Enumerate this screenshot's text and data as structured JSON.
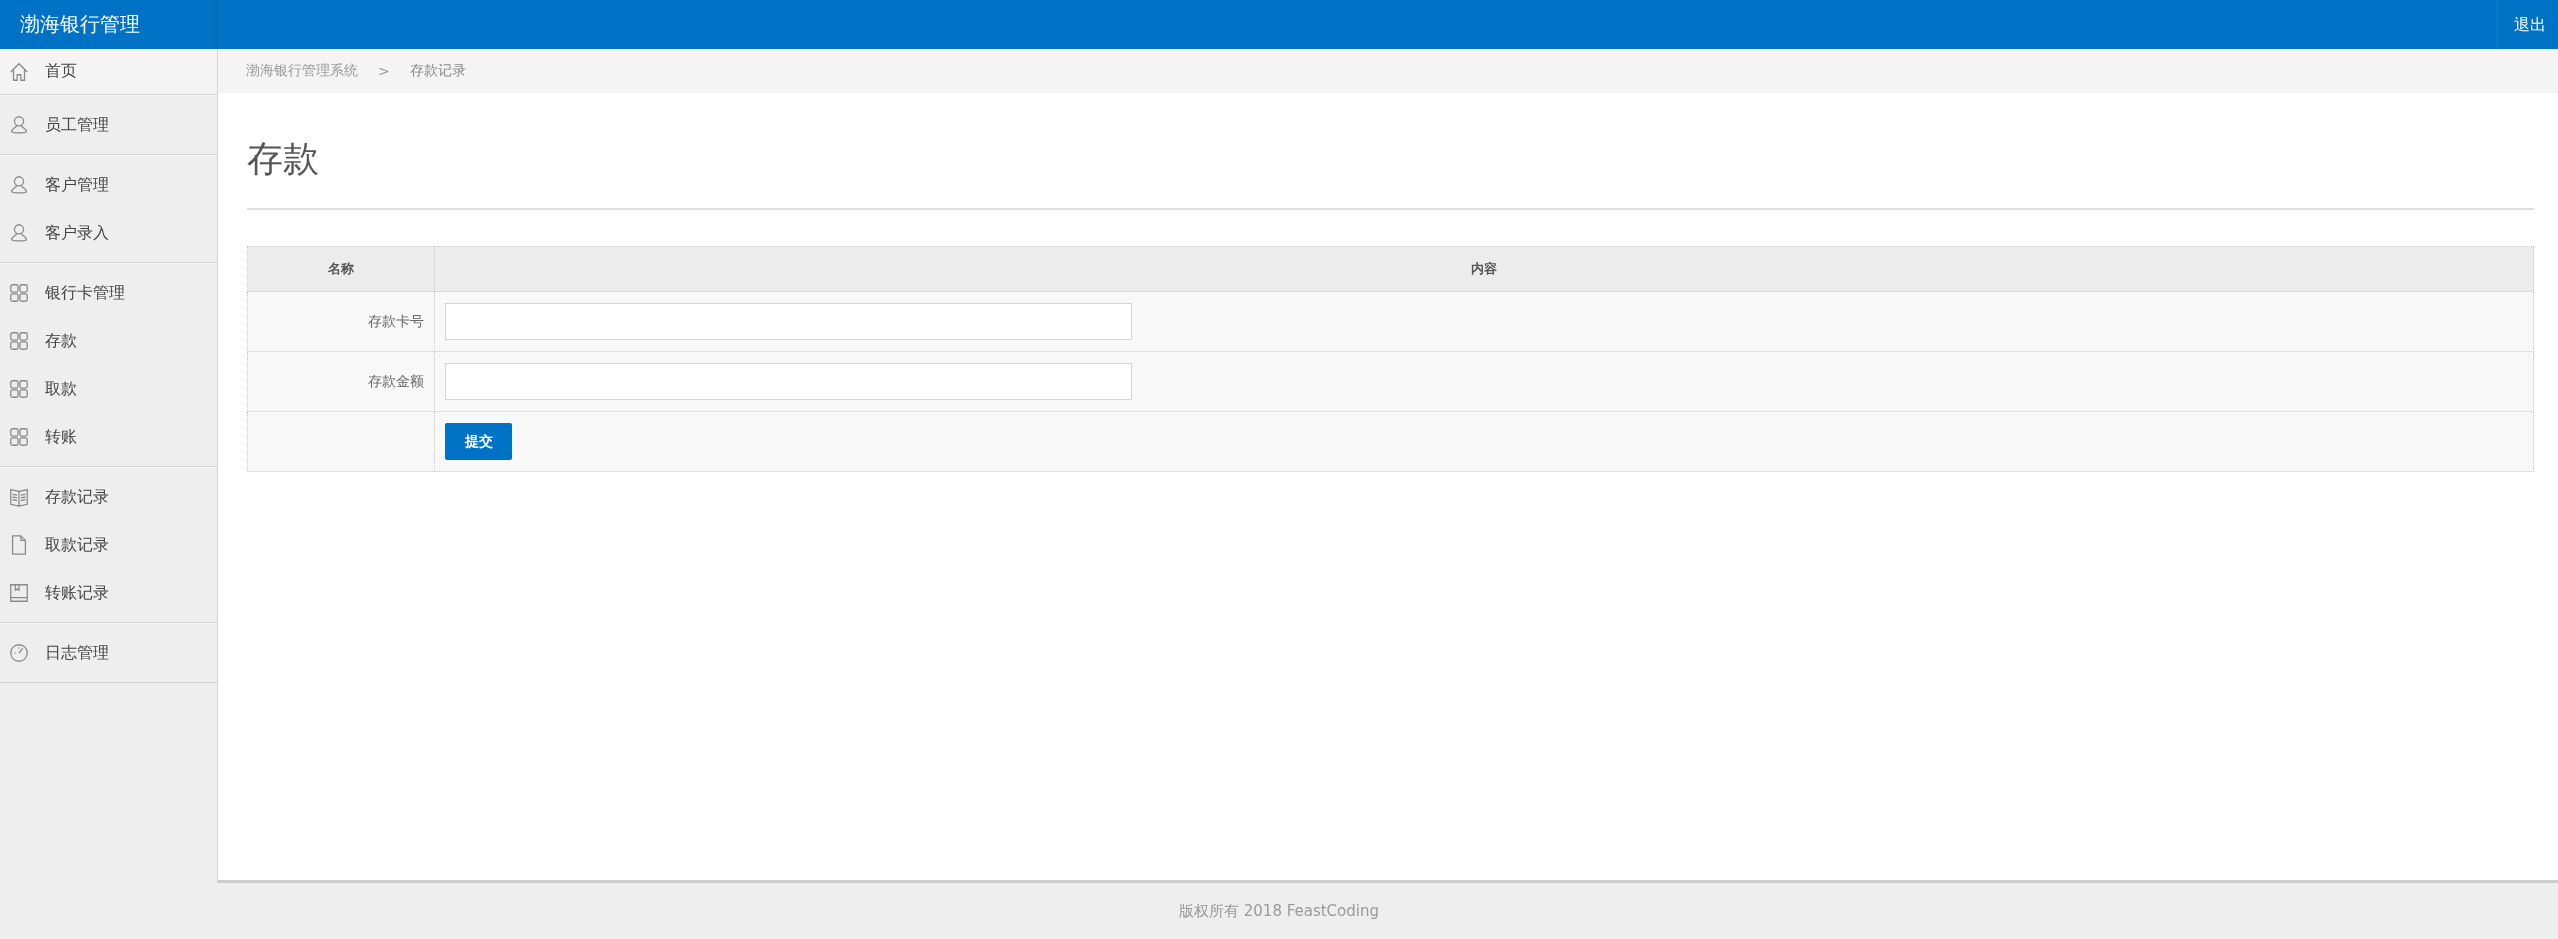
{
  "header": {
    "brand": "渤海银行管理",
    "logout": "退出"
  },
  "sidebar": {
    "groups": [
      {
        "items": [
          {
            "label": "首页",
            "kind": "home",
            "selected": true
          }
        ]
      },
      {
        "items": [
          {
            "label": "员工管理",
            "kind": "person",
            "selected": false
          }
        ]
      },
      {
        "items": [
          {
            "label": "客户管理",
            "kind": "person",
            "selected": false
          },
          {
            "label": "客户录入",
            "kind": "person",
            "selected": false
          }
        ]
      },
      {
        "items": [
          {
            "label": "银行卡管理",
            "kind": "grid",
            "selected": false
          },
          {
            "label": "存款",
            "kind": "grid",
            "selected": false
          },
          {
            "label": "取款",
            "kind": "grid",
            "selected": false
          },
          {
            "label": "转账",
            "kind": "grid",
            "selected": false
          }
        ]
      },
      {
        "items": [
          {
            "label": "存款记录",
            "kind": "book",
            "selected": false
          },
          {
            "label": "取款记录",
            "kind": "file",
            "selected": false
          },
          {
            "label": "转账记录",
            "kind": "notebook",
            "selected": false
          }
        ]
      },
      {
        "items": [
          {
            "label": "日志管理",
            "kind": "gauge",
            "selected": false
          }
        ]
      }
    ]
  },
  "breadcrumb": [
    "渤海银行管理系统",
    ">",
    "存款记录"
  ],
  "page_title": "存款",
  "form_table": {
    "columns": [
      "名称",
      "内容"
    ],
    "rows": [
      {
        "label": "存款卡号",
        "value": ""
      },
      {
        "label": "存款金额",
        "value": ""
      }
    ],
    "submit": "提交"
  },
  "footer": "版权所有 2018 FeastCoding"
}
